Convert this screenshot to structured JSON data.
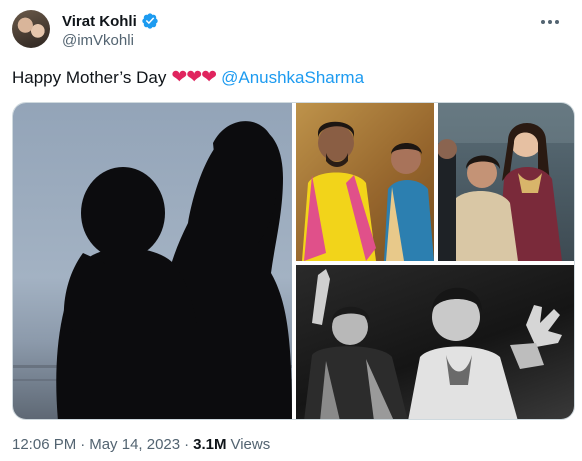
{
  "author": {
    "name": "Virat Kohli",
    "handle": "@imVkohli",
    "verified_color": "#1d9bf0"
  },
  "tweet": {
    "text": "Happy Mother’s Day",
    "hearts": "❤❤❤",
    "mention": "@AnushkaSharma",
    "heart_color": "#e0245e",
    "link_color": "#1d9bf0"
  },
  "media": {
    "images": [
      {
        "name": "silhouette-photo"
      },
      {
        "name": "family-photo-1"
      },
      {
        "name": "family-photo-2"
      },
      {
        "name": "dancing-photo"
      }
    ]
  },
  "footer": {
    "time": "12:06 PM",
    "separator": "·",
    "date": "May 14, 2023",
    "views_count": "3.1M",
    "views_label": "Views"
  },
  "icons": {
    "more": "more-icon",
    "verified": "verified-badge-icon"
  }
}
